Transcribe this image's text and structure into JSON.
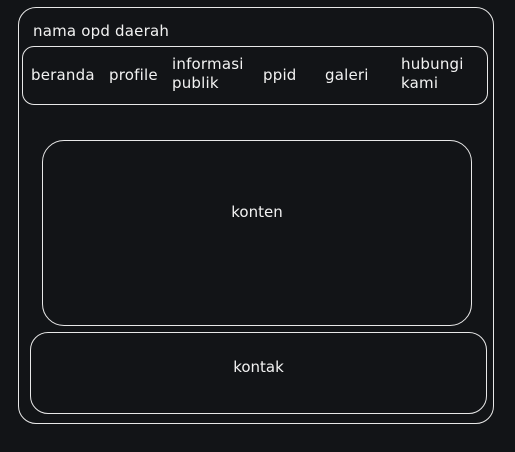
{
  "site": {
    "title": "nama opd daerah"
  },
  "nav": {
    "items": [
      {
        "label": "beranda"
      },
      {
        "label": "profile"
      },
      {
        "label": "informasi publik"
      },
      {
        "label": "ppid"
      },
      {
        "label": "galeri"
      },
      {
        "label": "hubungi kami"
      }
    ]
  },
  "main": {
    "content_label": "konten"
  },
  "footer": {
    "contact_label": "kontak"
  },
  "colors": {
    "background": "#121417",
    "stroke": "#e8e8e8",
    "text": "#f2f2f2"
  }
}
